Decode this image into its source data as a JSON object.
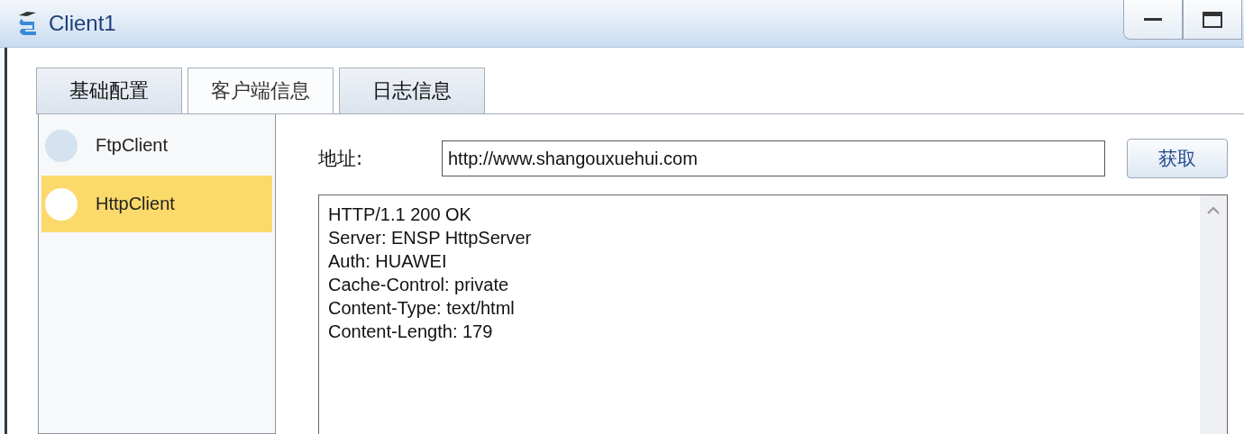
{
  "window": {
    "title": "Client1"
  },
  "tabs": [
    {
      "label": "基础配置",
      "selected": false
    },
    {
      "label": "客户端信息",
      "selected": true
    },
    {
      "label": "日志信息",
      "selected": false
    }
  ],
  "clients": [
    {
      "name": "FtpClient",
      "selected": false
    },
    {
      "name": "HttpClient",
      "selected": true
    }
  ],
  "address": {
    "label": "地址:",
    "value": "http://www.shangouxuehui.com"
  },
  "fetch_button": "获取",
  "response_lines": [
    "HTTP/1.1 200 OK",
    "Server: ENSP HttpServer",
    "Auth: HUAWEI",
    "Cache-Control: private",
    "Content-Type: text/html",
    "Content-Length: 179"
  ]
}
